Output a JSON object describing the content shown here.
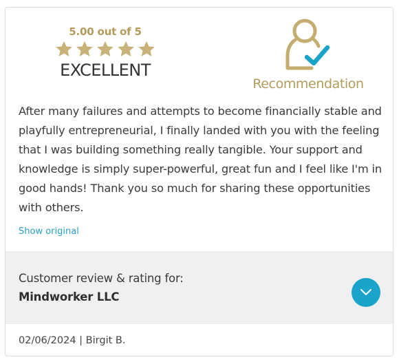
{
  "rating": {
    "score_text": "5.00 out of 5",
    "stars": 5,
    "label": "EXCELLENT"
  },
  "recommendation": {
    "icon": "user-check-icon",
    "label": "Recommendation"
  },
  "review": {
    "text": "After many failures and attempts to become financially stable and playfully entrepreneurial, I finally landed with you with the feeling that I was building something really tangible. Your support and knowledge is simply super-powerful, great fun and I feel like I'm in good hands! Thank you so much for sharing these opportunities with others.",
    "show_original_label": "Show original"
  },
  "company": {
    "caption": "Customer review & rating for:",
    "name": "Mindworker LLC"
  },
  "meta": {
    "date_author": "02/06/2024 | Birgit B."
  },
  "colors": {
    "gold": "#b39c5b",
    "star": "#c9b27a",
    "accent": "#1ba4c9",
    "link": "#2a9fc0",
    "section_bg": "#f0f0f0"
  }
}
